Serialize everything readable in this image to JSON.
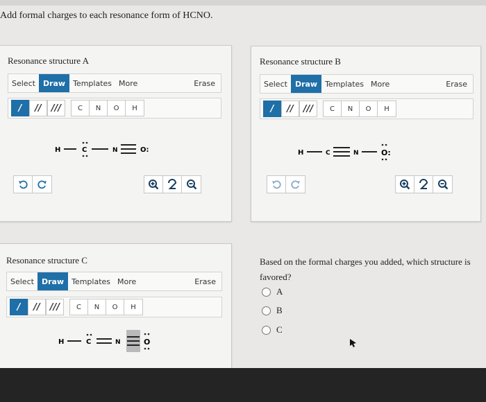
{
  "question": "Add formal charges to each resonance form of HCNO.",
  "toolbar": {
    "select": "Select",
    "draw": "Draw",
    "templates": "Templates",
    "more": "More",
    "erase": "Erase"
  },
  "tools": {
    "bonds": [
      "/",
      "//",
      "///"
    ],
    "atoms": [
      "C",
      "N",
      "O",
      "H"
    ]
  },
  "panels": {
    "a": {
      "title": "Resonance structure A"
    },
    "b": {
      "title": "Resonance structure B"
    },
    "c": {
      "title": "Resonance structure C"
    }
  },
  "molecules": {
    "a": {
      "atoms": [
        "H",
        "C",
        "N",
        "O:"
      ]
    },
    "b": {
      "atoms": [
        "H",
        "C",
        "N",
        "O:"
      ]
    },
    "c": {
      "atoms": [
        "H",
        "C",
        "N",
        "O"
      ]
    }
  },
  "mc": {
    "question": "Based on the formal charges you added, which structure is favored?",
    "options": [
      "A",
      "B",
      "C"
    ]
  }
}
